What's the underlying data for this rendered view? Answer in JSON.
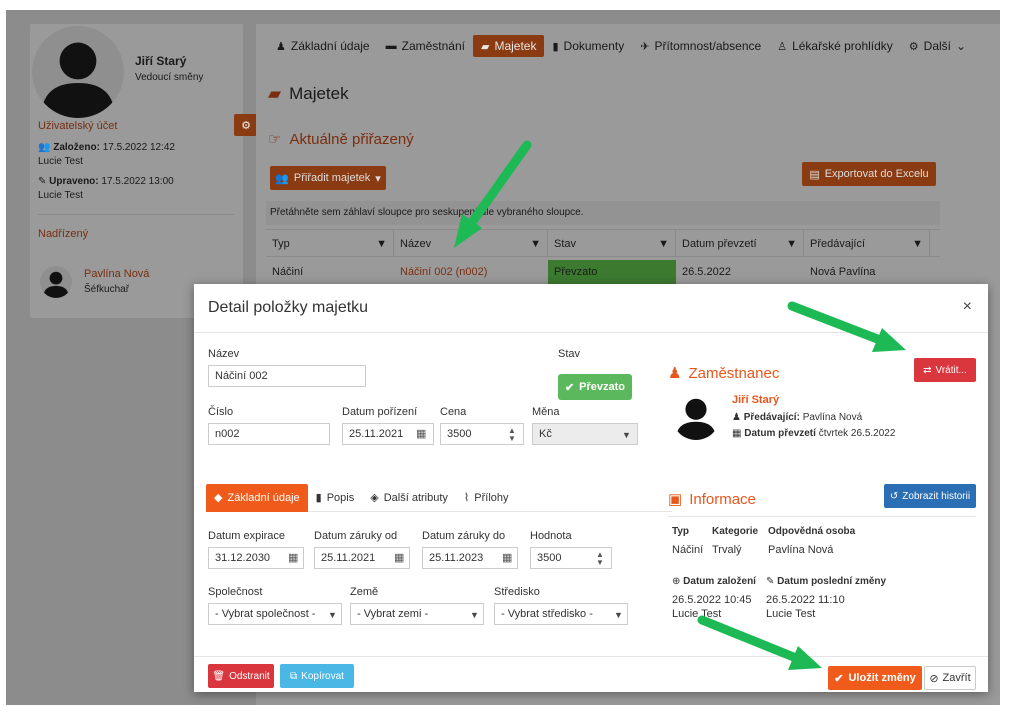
{
  "colors": {
    "accent": "#f05a1a",
    "danger": "#d9363e",
    "info": "#4ab8e4",
    "primary": "#2a6eb3",
    "success": "#5cb85c",
    "annotation_arrow": "#1db954"
  },
  "profile": {
    "name": "Jiří Starý",
    "role": "Vedoucí směny",
    "account_heading": "Uživatelský účet",
    "created_label": "Založeno:",
    "created_date": "17.5.2022 12:42",
    "created_by": "Lucie Test",
    "updated_label": "Upraveno:",
    "updated_date": "17.5.2022 13:00",
    "updated_by": "Lucie Test",
    "supervisor_heading": "Nadřízený",
    "supervisor_name": "Pavlína Nová",
    "supervisor_role": "Šéfkuchař"
  },
  "tabs": [
    {
      "label": "Základní údaje",
      "icon": "user-icon"
    },
    {
      "label": "Zaměstnání",
      "icon": "car-icon"
    },
    {
      "label": "Majetek",
      "icon": "book-icon"
    },
    {
      "label": "Dokumenty",
      "icon": "file-icon"
    },
    {
      "label": "Přítomnost/absence",
      "icon": "plane-icon"
    },
    {
      "label": "Lékařské prohlídky",
      "icon": "medic-icon"
    },
    {
      "label": "Další",
      "icon": "gears-icon"
    }
  ],
  "page": {
    "title": "Majetek",
    "subtitle": "Aktuálně přiřazený",
    "assign_button": "Přiřadit majetek",
    "export_button": "Exportovat do Excelu",
    "group_hint": "Přetáhněte sem záhlaví sloupce pro seskupení dle vybraného sloupce.",
    "grid_columns": [
      "Typ",
      "Název",
      "Stav",
      "Datum převzetí",
      "Předávající"
    ],
    "grid_rows": [
      [
        "Náčiní",
        "Náčiní 002 (n002)",
        "Převzato",
        "26.5.2022",
        "Nová Pavlína"
      ]
    ]
  },
  "modal": {
    "title": "Detail položky majetku",
    "close_symbol": "×",
    "name_label": "Název",
    "name_value": "Náčiní 002",
    "status_label": "Stav",
    "status_value": "Převzato",
    "number_label": "Číslo",
    "number_value": "n002",
    "purchase_date_label": "Datum pořízení",
    "purchase_date_value": "25.11.2021",
    "price_label": "Cena",
    "price_value": "3500",
    "currency_label": "Měna",
    "currency_value": "Kč",
    "subtabs": [
      "Základní údaje",
      "Popis",
      "Další atributy",
      "Přílohy"
    ],
    "expiry_label": "Datum expirace",
    "expiry_value": "31.12.2030",
    "warranty_from_label": "Datum záruky od",
    "warranty_from_value": "25.11.2021",
    "warranty_to_label": "Datum záruky do",
    "warranty_to_value": "25.11.2023",
    "value_label": "Hodnota",
    "value_value": "3500",
    "company_label": "Společnost",
    "company_value": "- Vybrat společnost -",
    "country_label": "Země",
    "country_value": "- Vybrat zemi -",
    "center_label": "Středisko",
    "center_value": "- Vybrat středisko -",
    "employee_heading": "Zaměstnanec",
    "return_button": "Vrátit...",
    "employee_name": "Jiří Starý",
    "handover_label": "Předávající:",
    "handover_value": "Pavlína Nová",
    "taken_label": "Datum převzetí",
    "taken_value": "čtvrtek 26.5.2022",
    "info_heading": "Informace",
    "history_button": "Zobrazit historii",
    "info_type_label": "Typ",
    "info_type_value": "Náčiní",
    "info_category_label": "Kategorie",
    "info_category_value": "Trvalý",
    "info_person_label": "Odpovědná osoba",
    "info_person_value": "Pavlína Nová",
    "created_label": "Datum založení",
    "created_value": "26.5.2022 10:45",
    "created_by": "Lucie Test",
    "changed_label": "Datum poslední změny",
    "changed_value": "26.5.2022 11:10",
    "changed_by": "Lucie Test",
    "delete_button": "Odstranit",
    "copy_button": "Kopírovat",
    "save_button": "Uložit změny",
    "close_button": "Zavřít"
  }
}
